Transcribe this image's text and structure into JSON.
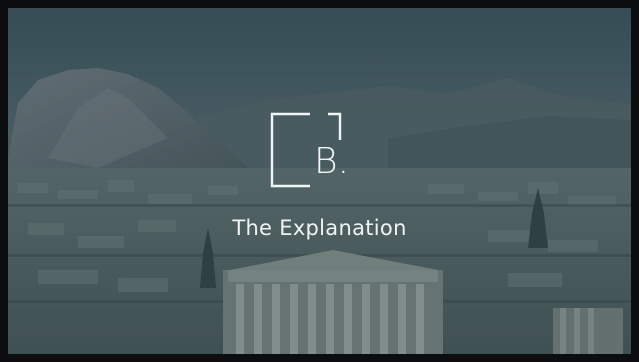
{
  "slide": {
    "logo_letter": "B.",
    "title": "The Explanation"
  },
  "icons": {
    "logo": "bracket-logo-icon",
    "background": "athens-acropolis-photo"
  },
  "colors": {
    "overlay": "#2e4652",
    "text": "#f2f5f6",
    "frame": "#0b0d0e"
  }
}
